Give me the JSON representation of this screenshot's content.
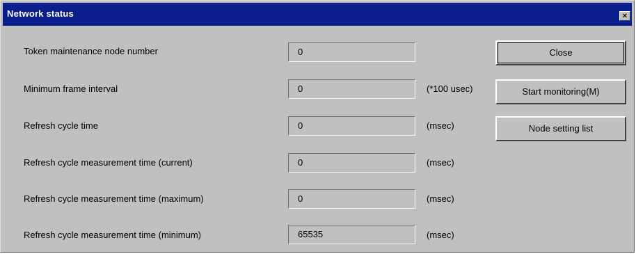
{
  "window": {
    "title": "Network status",
    "close_glyph": "×"
  },
  "rows": [
    {
      "label": "Token maintenance node number",
      "value": "0",
      "unit": ""
    },
    {
      "label": "Minimum frame interval",
      "value": "0",
      "unit": "(*100 usec)"
    },
    {
      "label": "Refresh cycle time",
      "value": "0",
      "unit": "(msec)"
    },
    {
      "label": "Refresh cycle measurement time (current)",
      "value": "0",
      "unit": "(msec)"
    },
    {
      "label": "Refresh cycle measurement time (maximum)",
      "value": "0",
      "unit": "(msec)"
    },
    {
      "label": "Refresh cycle measurement time (minimum)",
      "value": "65535",
      "unit": "(msec)"
    }
  ],
  "buttons": {
    "close": "Close",
    "start_monitoring": "Start monitoring(M)",
    "node_setting_list": "Node setting list"
  },
  "colors": {
    "titlebar": "#0a1f8c",
    "dialog_bg": "#c0c0c0"
  }
}
